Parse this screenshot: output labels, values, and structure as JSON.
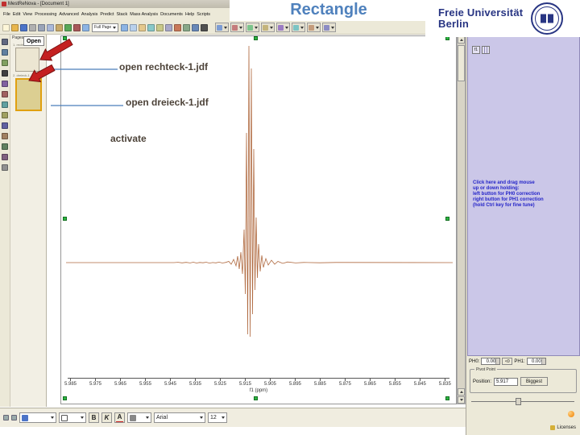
{
  "slide": {
    "title": "Rectangle"
  },
  "annotations": {
    "open_rechteck": "open rechteck-1.jdf",
    "open_dreieck": "open dreieck-1.jdf",
    "activate": "activate"
  },
  "logo": {
    "name_line1": "Freie Universität",
    "name_line2": "Berlin"
  },
  "app": {
    "titlebar": "MestReNova - [Document 1]",
    "menus": [
      "File",
      "Edit",
      "View",
      "Processing",
      "Advanced",
      "Analysis",
      "Predict",
      "Stack",
      "Mass Analysis",
      "Documents",
      "Help",
      "Scripts"
    ],
    "toolbar": {
      "zoom_dropdown": "Full Page",
      "icons_left": [
        {
          "n": "new-document-icon",
          "c": "#fdf6d8"
        },
        {
          "n": "open-file-icon",
          "c": "#e8b64c"
        },
        {
          "n": "save-icon",
          "c": "#4c74c8"
        },
        {
          "n": "print-icon",
          "c": "#b0b0b0"
        },
        {
          "n": "cut-icon",
          "c": "#9aa4b8"
        },
        {
          "n": "copy-icon",
          "c": "#aab8d8"
        },
        {
          "n": "paste-icon",
          "c": "#c8a868"
        },
        {
          "n": "undo-icon",
          "c": "#58a858"
        },
        {
          "n": "redo-icon",
          "c": "#a85858"
        },
        {
          "n": "zoom-in-icon",
          "c": "#8cb4e4"
        }
      ],
      "icons_right": [
        {
          "n": "zoom-out-icon",
          "c": "#8cb4e4"
        },
        {
          "n": "fit-page-icon",
          "c": "#b8d0ec"
        },
        {
          "n": "pan-icon",
          "c": "#e4c88c"
        },
        {
          "n": "crosshair-icon",
          "c": "#88c8c8"
        },
        {
          "n": "ruler-icon",
          "c": "#c8c888"
        },
        {
          "n": "grid-icon",
          "c": "#a8a8c8"
        },
        {
          "n": "spectrum-icon",
          "c": "#c87858"
        },
        {
          "n": "table-icon",
          "c": "#88a888"
        },
        {
          "n": "molecule-icon",
          "c": "#6888b8"
        },
        {
          "n": "text-tool-icon",
          "c": "#505050"
        }
      ],
      "groups": [
        {
          "n": "processing-tools-dropdown",
          "c": "#7c9cd4"
        },
        {
          "n": "phase-correction-dropdown",
          "c": "#c47c7c"
        },
        {
          "n": "baseline-dropdown",
          "c": "#7cc48c"
        },
        {
          "n": "integration-dropdown",
          "c": "#c4b47c"
        },
        {
          "n": "peak-picking-dropdown",
          "c": "#9c7cc4"
        },
        {
          "n": "multiplet-dropdown",
          "c": "#7cc4c4"
        },
        {
          "n": "assignment-dropdown",
          "c": "#c49c7c"
        },
        {
          "n": "view-options-dropdown",
          "c": "#8c8cc4"
        }
      ]
    },
    "left_toolbar_icons": [
      {
        "n": "pointer-tool-icon",
        "c": "#606880"
      },
      {
        "n": "zoom-tool-icon",
        "c": "#6080a0"
      },
      {
        "n": "pan-tool-icon",
        "c": "#80a060"
      },
      {
        "n": "text-annotation-icon",
        "c": "#404040"
      },
      {
        "n": "line-tool-icon",
        "c": "#8060a0"
      },
      {
        "n": "arrow-tool-icon",
        "c": "#a06060"
      },
      {
        "n": "rectangle-tool-icon",
        "c": "#60a0a0"
      },
      {
        "n": "ellipse-tool-icon",
        "c": "#a0a060"
      },
      {
        "n": "polygon-tool-icon",
        "c": "#6060a0"
      },
      {
        "n": "image-tool-icon",
        "c": "#a08060"
      },
      {
        "n": "table-tool-icon",
        "c": "#608060"
      },
      {
        "n": "chart-tool-icon",
        "c": "#806080"
      },
      {
        "n": "eraser-tool-icon",
        "c": "#909090"
      }
    ],
    "pages_panel": {
      "header": "Pages",
      "tooltip": "Open",
      "items": [
        {
          "label": "1. rechteck-1"
        },
        {
          "label": "2. dreieck-1"
        }
      ]
    },
    "canvas": {
      "axis_labels": [
        "5.985",
        "5.975",
        "5.965",
        "5.955",
        "5.945",
        "5.935",
        "5.925",
        "5.915",
        "5.905",
        "5.895",
        "5.885",
        "5.875",
        "5.865",
        "5.855",
        "5.845",
        "5.835"
      ],
      "axis_title": "f1 (ppm)"
    },
    "phase_panel": {
      "f1_button": "f1",
      "instructions": [
        "Click here and drag mouse",
        "up or down holding:",
        "left button for PH0 correction",
        "right button for PH1 correction",
        "(hold Ctrl key for fine tune)"
      ],
      "ph0_label": "PH0:",
      "ph0_value": "0.00",
      "reset_label": "<0",
      "ph1_label": "PH1:",
      "ph1_value": "0.00",
      "pivot_title": "Pivot Point",
      "position_label": "Position:",
      "position_value": "5.917",
      "biggest_label": "Biggest"
    },
    "bottom_toolbar": {
      "bold": "B",
      "italic": "K",
      "color": "A",
      "font": "Arial",
      "size": "12"
    },
    "licenses": "Licenses"
  },
  "colors": {
    "title_blue": "#4F81BD",
    "annotation_brown": "#4D4339",
    "panel_lavender": "#CBC7E8",
    "arrow_red": "#C42020",
    "handle_green": "#2FB344",
    "spectrum_brown": "#B06A40",
    "fu_blue": "#283583",
    "connector_blue": "#4A7EBB"
  }
}
